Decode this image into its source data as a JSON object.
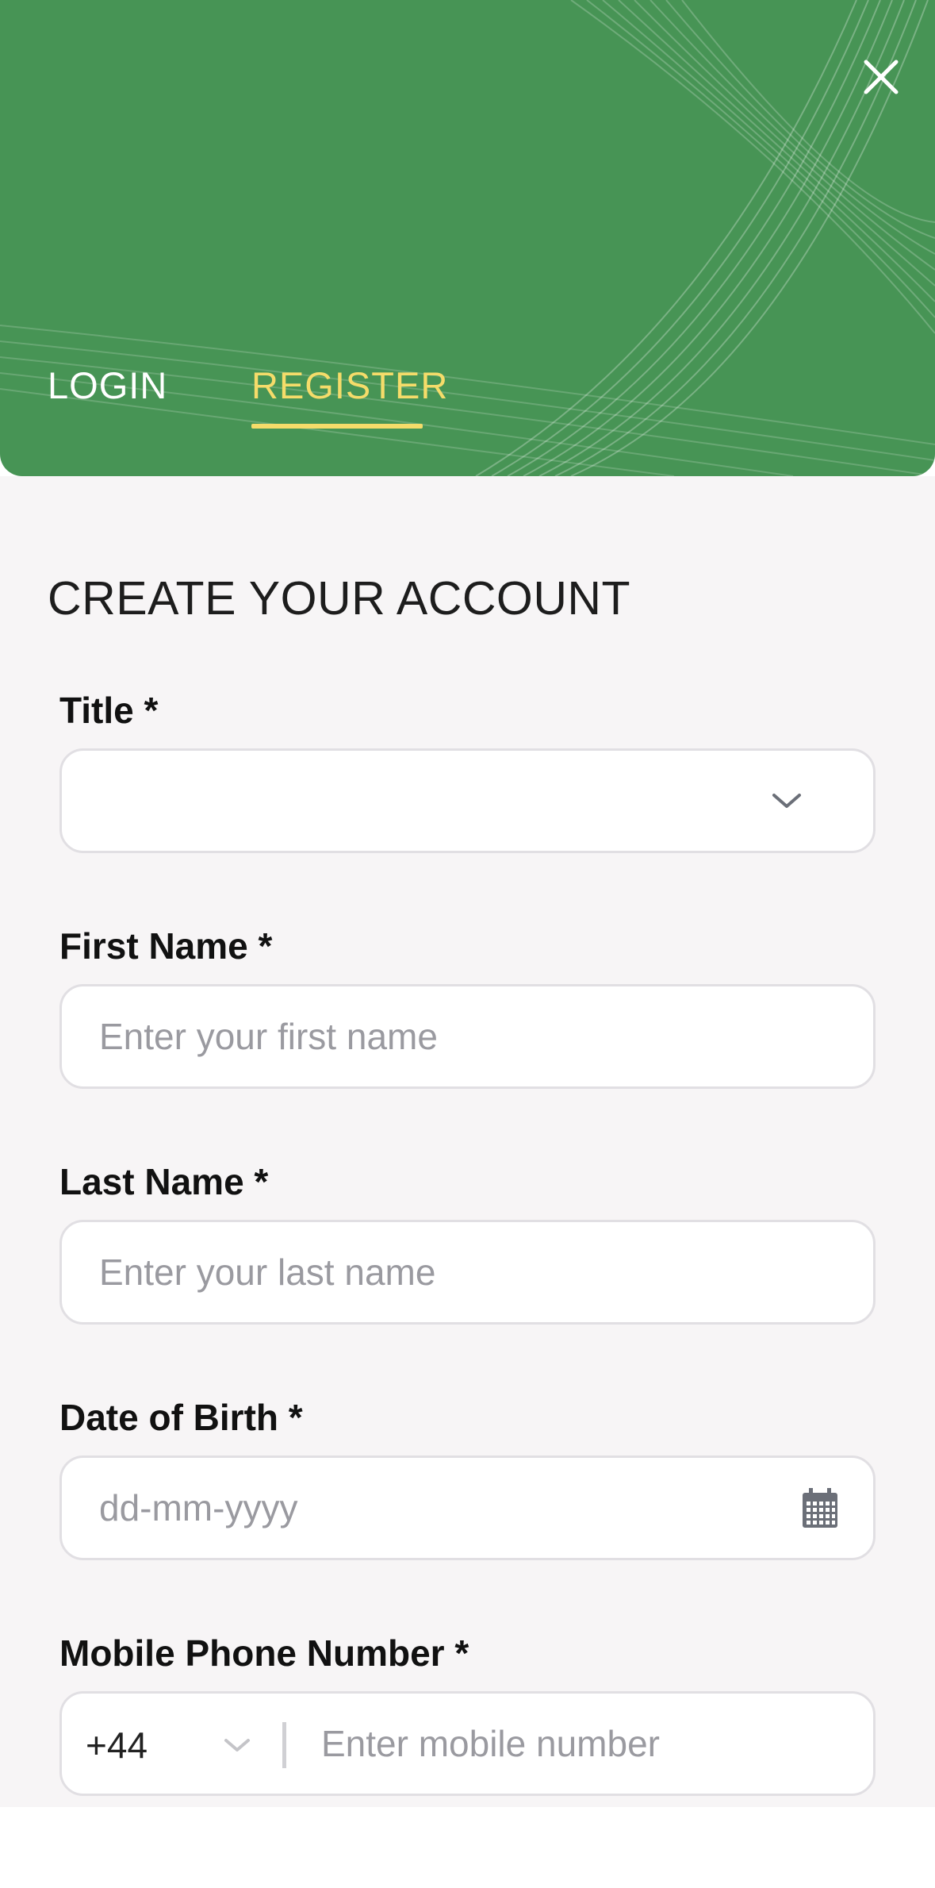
{
  "header": {
    "background_color": "#479455",
    "accent_color": "#f5dc6a",
    "tabs": [
      {
        "label": "LOGIN",
        "active": false
      },
      {
        "label": "REGISTER",
        "active": true
      }
    ],
    "close_icon": "close-icon"
  },
  "form": {
    "title": "CREATE YOUR ACCOUNT",
    "fields": {
      "title": {
        "label": "Title *",
        "value": "",
        "icon": "chevron-down-icon"
      },
      "first_name": {
        "label": "First Name *",
        "placeholder": "Enter your first name"
      },
      "last_name": {
        "label": "Last Name *",
        "placeholder": "Enter your last name"
      },
      "dob": {
        "label": "Date of Birth *",
        "placeholder": "dd-mm-yyyy",
        "icon": "calendar-icon"
      },
      "mobile": {
        "label": "Mobile Phone Number *",
        "country_code": "+44",
        "placeholder": "Enter mobile number"
      }
    }
  }
}
